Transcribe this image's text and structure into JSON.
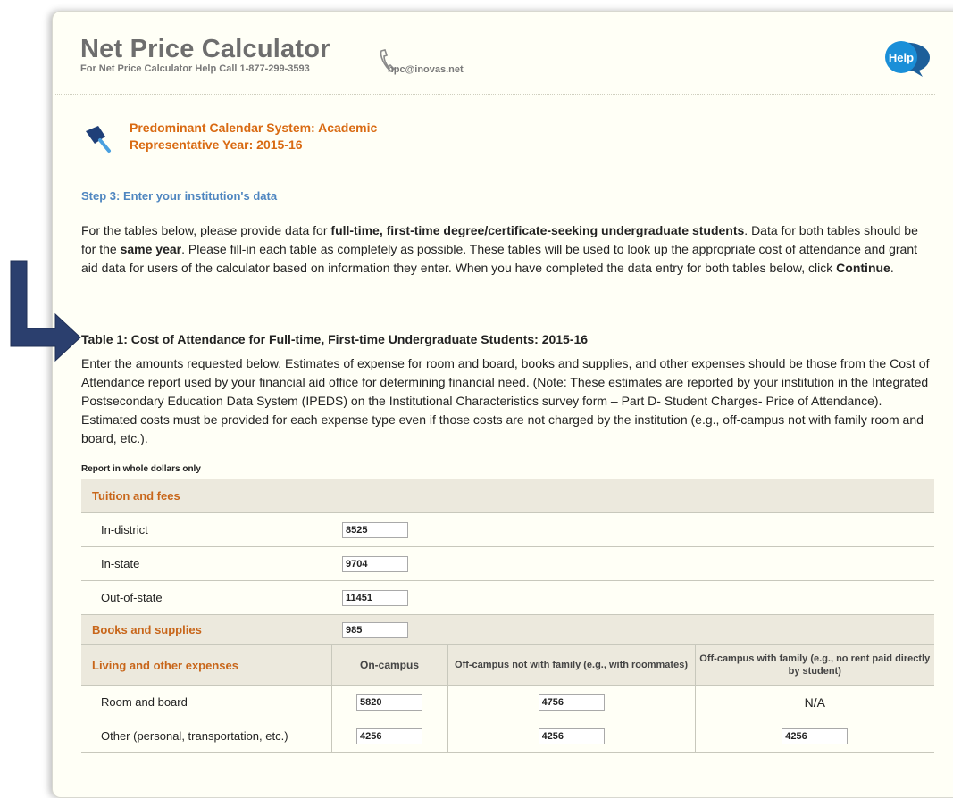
{
  "header": {
    "title": "Net Price Calculator",
    "help_line": "For Net Price Calculator Help Call 1-877-299-3593",
    "email": "npc@inovas.net",
    "help_badge": "Help"
  },
  "calendar": {
    "system": "Predominant Calendar System: Academic",
    "year": "Representative Year: 2015-16"
  },
  "step": "Step 3: Enter your institution's data",
  "intro": {
    "p1": "For the tables below, please provide data for ",
    "b1": "full-time, first-time degree/certificate-seeking undergraduate students",
    "p2": ". Data for both tables should be for the ",
    "b2": "same year",
    "p3": ". Please fill-in each table as completely as possible. These tables will be used to look up the appropriate cost of attendance and grant aid data for users of the calculator based on information they enter. When you have completed the data entry for both tables below, click ",
    "b3": "Continue",
    "p4": "."
  },
  "table1": {
    "title": "Table 1: Cost of Attendance for Full-time, First-time Undergraduate Students: 2015-16",
    "description": "Enter the amounts requested below. Estimates of expense for room and board, books and supplies, and other expenses should be those from the Cost of Attendance report used by your financial aid office for determining financial need. (Note: These estimates are reported by your institution in the Integrated Postsecondary Education Data System (IPEDS) on the Institutional Characteristics survey form – Part D- Student Charges- Price of Attendance). Estimated costs must be provided for each expense type even if those costs are not charged by the institution (e.g., off-campus not with family room and board, etc.).",
    "report_note": "Report in whole dollars only",
    "tuition_label": "Tuition and fees",
    "in_district_label": "In-district",
    "in_district": "8525",
    "in_state_label": "In-state",
    "in_state": "9704",
    "out_state_label": "Out-of-state",
    "out_state": "11451",
    "books_label": "Books and supplies",
    "books": "985",
    "living_label": "Living and other expenses",
    "col_on_campus": "On-campus",
    "col_off_not_family": "Off-campus not with family (e.g., with roommates)",
    "col_off_with_family": "Off-campus with family (e.g., no rent paid directly by student)",
    "room_board_label": "Room and board",
    "room_board_on": "5820",
    "room_board_off": "4756",
    "room_board_family": "N/A",
    "other_label": "Other (personal, transportation, etc.)",
    "other_on": "4256",
    "other_off": "4256",
    "other_family": "4256"
  },
  "colors": {
    "accent_orange": "#d96a12",
    "step_blue": "#4f86c0",
    "help_blue": "#1a8fd8",
    "arrow_navy": "#2b3f6e"
  }
}
